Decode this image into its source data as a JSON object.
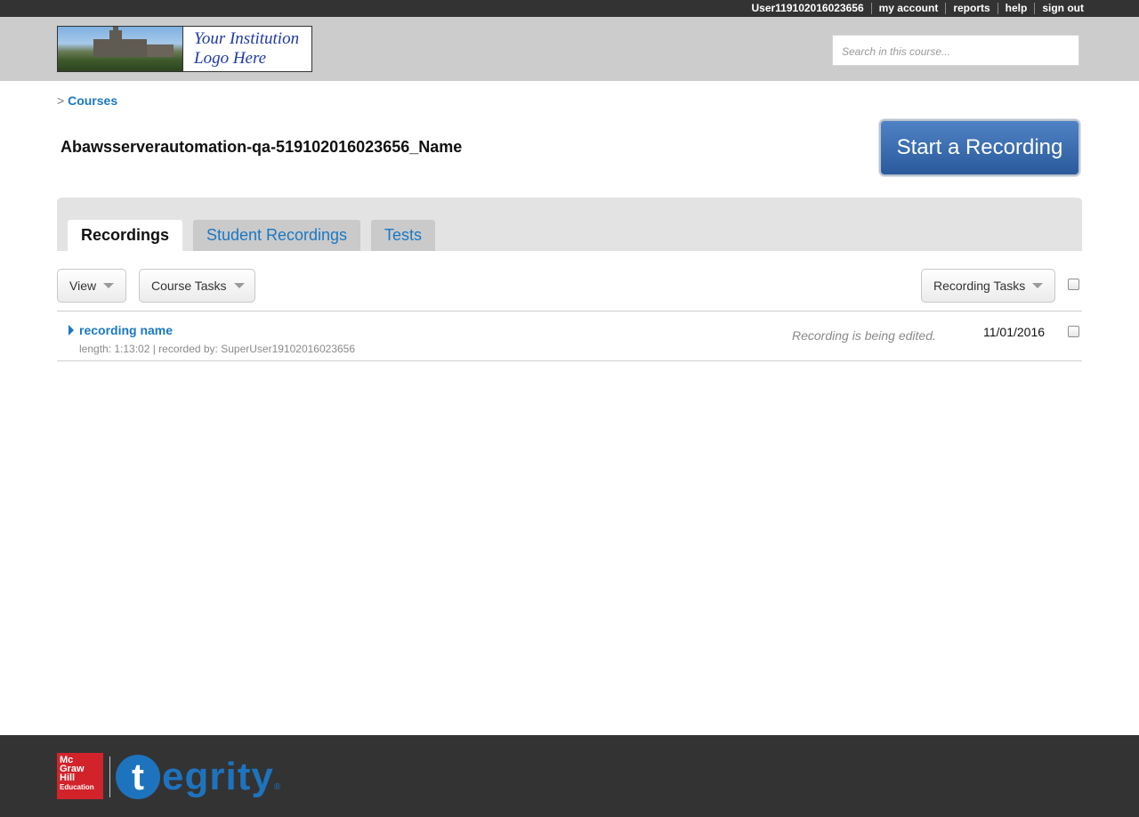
{
  "topnav": {
    "username": "User119102016023656",
    "my_account": "my account",
    "reports": "reports",
    "help": "help",
    "sign_out": "sign out"
  },
  "header": {
    "logo_line1": "Your Institution",
    "logo_line2": "Logo Here",
    "search_placeholder": "Search in this course..."
  },
  "breadcrumb": {
    "separator": ">",
    "courses": "Courses"
  },
  "course": {
    "title": "Abawsserverautomation-qa-519102016023656_Name",
    "start_recording": "Start a Recording"
  },
  "tabs": [
    {
      "label": "Recordings",
      "active": true
    },
    {
      "label": "Student Recordings",
      "active": false
    },
    {
      "label": "Tests",
      "active": false
    }
  ],
  "toolbar": {
    "view": "View",
    "course_tasks": "Course Tasks",
    "recording_tasks": "Recording Tasks"
  },
  "recordings": [
    {
      "name": "recording name",
      "meta": "length: 1:13:02 | recorded by: SuperUser19102016023656",
      "status": "Recording is being edited.",
      "date": "11/01/2016"
    }
  ],
  "footer": {
    "mgh_line1": "Mc",
    "mgh_line2": "Graw",
    "mgh_line3": "Hill",
    "mgh_line4": "Education",
    "tegrity_t": "t",
    "tegrity_rest": "egrity",
    "tegrity_mark": "®"
  },
  "colors": {
    "link_blue": "#1a78c2",
    "topbar": "#333333",
    "header_bg": "#cccccc",
    "start_button": "#2a5a9c",
    "mgh_red": "#d2232a",
    "tegrity_blue": "#1e73be"
  }
}
